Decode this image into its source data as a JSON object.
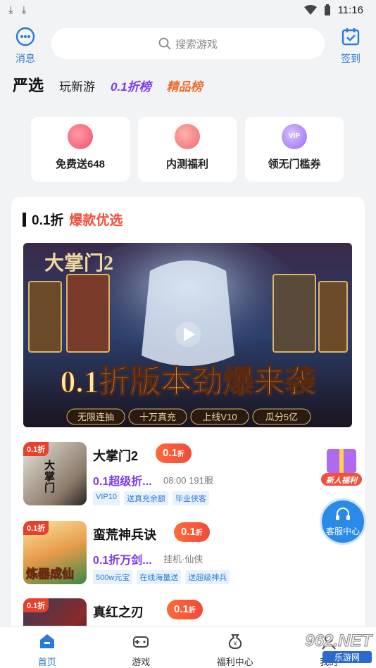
{
  "status": {
    "time": "11:16"
  },
  "header": {
    "messages_label": "消息",
    "search_placeholder": "搜索游戏",
    "checkin_label": "签到"
  },
  "tabs": [
    "严选",
    "玩新游",
    "0.1折榜",
    "精品榜"
  ],
  "perks": [
    {
      "label": "免费送648",
      "color": "#f25a6a"
    },
    {
      "label": "内测福利",
      "color": "#f06a6a"
    },
    {
      "label": "领无门槛券",
      "color": "#9a6af0",
      "badge": "VIP"
    }
  ],
  "section": {
    "title_main": "0.1折",
    "title_hot": "爆款优选"
  },
  "banner": {
    "headline": "0.1折版本劲爆来袭",
    "logo_text": "大掌门2",
    "chips": [
      "无限连抽",
      "十万真充",
      "上线V10",
      "瓜分5亿"
    ]
  },
  "games": [
    {
      "name": "大掌门2",
      "discount": "0.1",
      "discount_unit": "折",
      "sub": "0.1超级折...",
      "meta": "08:00 191服",
      "tags": [
        "VIP10",
        "送真充余额",
        "毕业侠客"
      ],
      "thumb_badge": "0.1折",
      "thumb_text": "大掌门"
    },
    {
      "name": "蛮荒神兵诀",
      "discount": "0.1",
      "discount_unit": "折",
      "sub": "0.1折万剑...",
      "meta": "挂机·仙侠",
      "tags": [
        "500w元宝",
        "在线海量送",
        "送超级神兵"
      ],
      "thumb_badge": "0.1折",
      "thumb_text": "炼器成仙"
    },
    {
      "name": "真红之刃",
      "discount": "0.1",
      "discount_unit": "折",
      "thumb_badge": "0.1折"
    }
  ],
  "floating": {
    "gift_label": "新人福利",
    "service_label": "客服中心"
  },
  "nav": [
    {
      "label": "首页",
      "active": true
    },
    {
      "label": "游戏",
      "active": false
    },
    {
      "label": "福利中心",
      "active": false
    },
    {
      "label": "我的",
      "active": false
    }
  ],
  "watermark": {
    "main": "962.NET",
    "sub": "乐游网"
  }
}
